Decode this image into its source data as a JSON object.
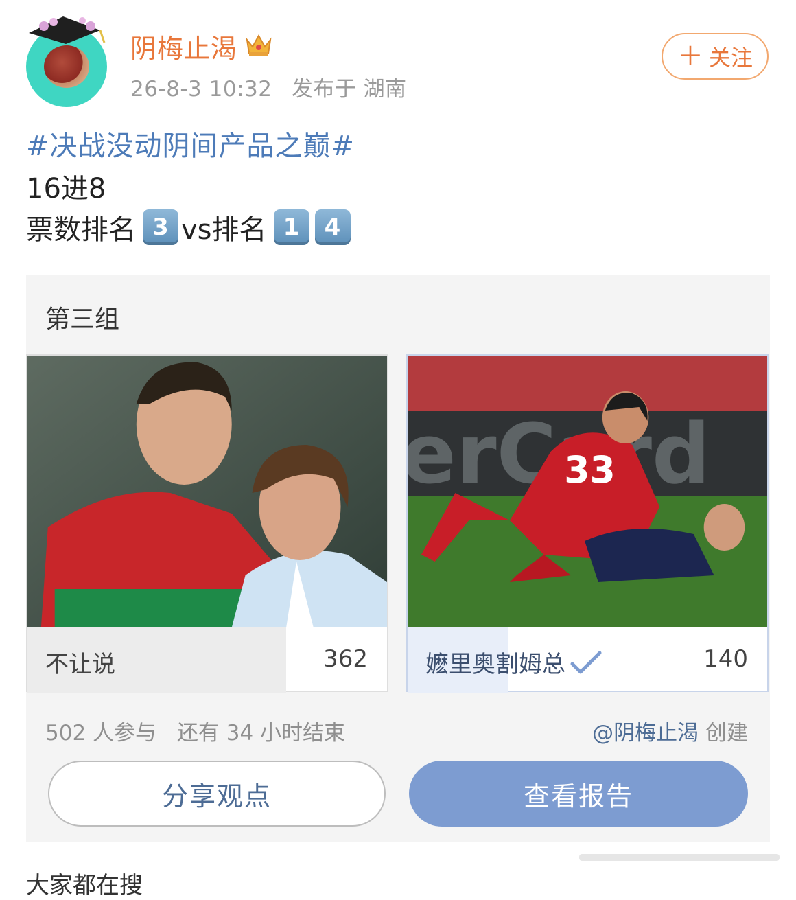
{
  "post": {
    "author_name": "阴梅止渴",
    "timestamp": "26-8-3 10:32",
    "location": "发布于 湖南",
    "follow_label": "关注",
    "hashtag": "#决战没动阴间产品之巅#",
    "line2": "16进8",
    "line3_prefix": "票数排名",
    "line3_mid": "vs排名",
    "keycaps": [
      "3",
      "1",
      "4"
    ]
  },
  "poll": {
    "title": "第三组",
    "options": [
      {
        "label": "不让说",
        "count": "362",
        "share": 0.72,
        "selected": false
      },
      {
        "label": "嬷里奥割姆总",
        "count": "140",
        "share": 0.28,
        "selected": true
      }
    ],
    "participants": "502 人参与",
    "remaining": "还有 34 小时结束",
    "creator_mention": "@阴梅止渴",
    "creator_suffix": "创建",
    "share_label": "分享观点",
    "report_label": "查看报告"
  },
  "footer_cut_text": "大家都在搜",
  "icons": {
    "crown": "crown-icon",
    "check": "check-icon",
    "plus": "plus-icon"
  },
  "colors": {
    "author": "#e8773b",
    "hashtag": "#4d7bb8",
    "report_button": "#7d9cd1"
  }
}
